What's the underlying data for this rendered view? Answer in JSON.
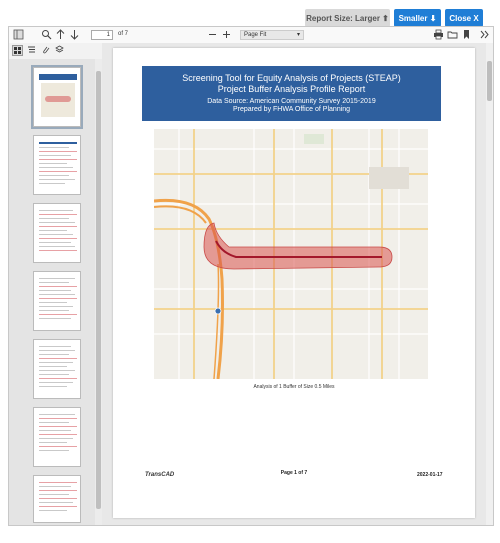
{
  "top_buttons": {
    "report_size": "Report Size: Larger ⬆",
    "smaller": "Smaller ⬇",
    "close": "Close X"
  },
  "toolbar": {
    "page_number": "1",
    "page_total": "of 7",
    "zoom_value": "Page Fit",
    "icons": [
      "sidebar-toggle-icon",
      "search-icon",
      "arrow-up-icon",
      "arrow-down-icon",
      "zoom-out-icon",
      "zoom-in-icon",
      "print-icon",
      "folder-icon",
      "bookmark-icon",
      "more-icon"
    ]
  },
  "sidebar": {
    "tabs": [
      "thumbnails-icon",
      "outline-icon",
      "attachments-icon",
      "layers-icon"
    ]
  },
  "report": {
    "title_line1": "Screening Tool for Equity Analysis of Projects  (STEAP)",
    "title_line2": "Project Buffer Analysis Profile Report",
    "source": "Data Source: American Community Survey 2015-2019",
    "prepared": "Prepared by FHWA Office of Planning",
    "caption": "Analysis of 1 Buffer of Size 0.5 Miles",
    "footer_logo": "TransCAD",
    "footer_page": "Page 1 of 7",
    "footer_date": "2022-01-17"
  },
  "colors": {
    "accent_blue": "#1f7ed6",
    "banner_blue": "#2e5f9e",
    "buffer_red": "#d9534f"
  }
}
